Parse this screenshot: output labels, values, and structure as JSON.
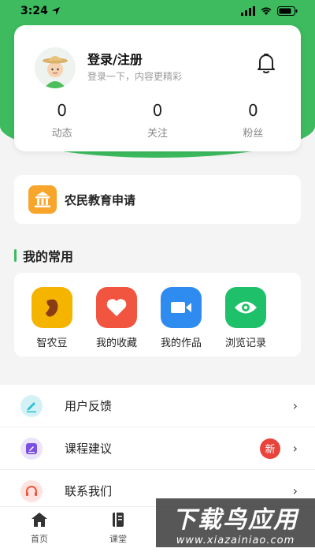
{
  "status_bar": {
    "time": "3:24"
  },
  "profile": {
    "title": "登录/注册",
    "subtitle": "登录一下，内容更精彩",
    "stats": [
      {
        "value": "0",
        "label": "动态"
      },
      {
        "value": "0",
        "label": "关注"
      },
      {
        "value": "0",
        "label": "粉丝"
      }
    ]
  },
  "edu": {
    "label": "农民教育申请"
  },
  "common": {
    "title": "我的常用",
    "items": [
      {
        "label": "智农豆",
        "icon": "bean-icon",
        "color": "#f5b400"
      },
      {
        "label": "我的收藏",
        "icon": "heart-icon",
        "color": "#f2553f"
      },
      {
        "label": "我的作品",
        "icon": "video-camera-icon",
        "color": "#2e8cf0"
      },
      {
        "label": "浏览记录",
        "icon": "eye-icon",
        "color": "#1fc06a"
      }
    ]
  },
  "menu": [
    {
      "label": "用户反馈",
      "icon": "edit-icon",
      "color": "#29c3d6"
    },
    {
      "label": "课程建议",
      "icon": "suggestion-icon",
      "color": "#7b4fe0",
      "badge": "新"
    },
    {
      "label": "联系我们",
      "icon": "headset-icon",
      "color": "#f2553f"
    }
  ],
  "tabs": [
    {
      "label": "首页",
      "icon": "home-icon"
    },
    {
      "label": "课堂",
      "icon": "book-icon"
    }
  ],
  "watermark": {
    "big": "下载鸟应用",
    "small": "www.xiazainiao.com"
  },
  "colors": {
    "brand_green": "#3dbb5e",
    "badge_red": "#e9433b"
  }
}
